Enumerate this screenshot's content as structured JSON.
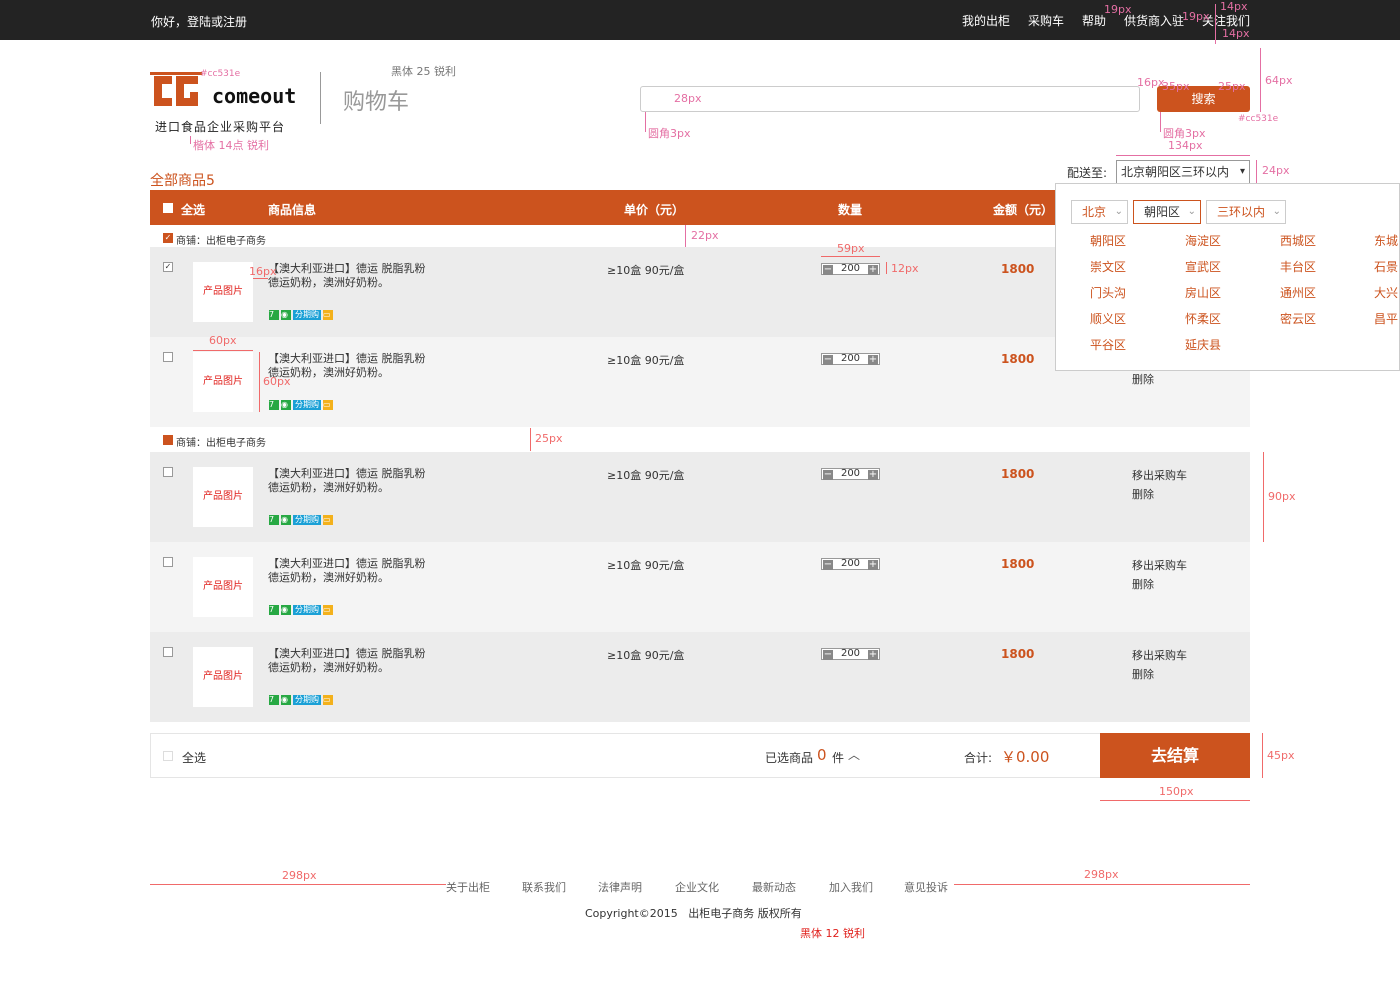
{
  "topbar": {
    "greeting": "你好，登陆或注册",
    "nav": [
      "我的出柜",
      "采购车",
      "帮助",
      "供货商入驻",
      "关注我们"
    ]
  },
  "header": {
    "logo_text": "comeout",
    "tagline": "进口食品企业采购平台",
    "page_title": "购物车",
    "search_button": "搜索",
    "brand_color": "#cc531e"
  },
  "cart": {
    "count_label": "全部商品5",
    "delivery_label": "配送至:",
    "delivery_value": "北京朝阳区三环以内",
    "columns": {
      "select_all": "全选",
      "info": "商品信息",
      "price": "单价（元）",
      "qty": "数量",
      "amount": "金额（元）"
    },
    "shops": [
      "商铺：出柜电子商务",
      "商铺：出柜电子商务"
    ],
    "item": {
      "image": "产品图片",
      "title_line1": "【澳大利亚进口】德运 脱脂乳粉",
      "title_line2": "德运奶粉，澳洲好奶粉。",
      "price": "≥10盒 90元/盒",
      "qty": "200",
      "amount": "1800",
      "remove": "移出采购车",
      "delete": "删除",
      "badge_installment": "分期购"
    }
  },
  "summary": {
    "select_all": "全选",
    "selected_prefix": "已选商品",
    "selected_count": "0",
    "selected_suffix": "件",
    "total_label": "合计:",
    "total_value": "￥0.00",
    "checkout": "去结算"
  },
  "region_popup": {
    "province": "北京",
    "district": "朝阳区",
    "ring": "三环以内",
    "districts": [
      "朝阳区",
      "海淀区",
      "西城区",
      "东城",
      "崇文区",
      "宣武区",
      "丰台区",
      "石景",
      "门头沟",
      "房山区",
      "通州区",
      "大兴",
      "顺义区",
      "怀柔区",
      "密云区",
      "昌平",
      "平谷区",
      "延庆县"
    ]
  },
  "footer": {
    "links": [
      "关于出柜",
      "联系我们",
      "法律声明",
      "企业文化",
      "最新动态",
      "加入我们",
      "意见投诉"
    ],
    "copyright": "Copyright©2015   出柜电子商务 版权所有"
  },
  "annotations": {
    "font_title": "黑体 25 锐利",
    "font_tagline": "楷体 14点 锐利",
    "font_footer": "黑体 12 锐利",
    "color1": "#cc531e",
    "color2": "#cc531e",
    "px14a": "14px",
    "px14b": "14px",
    "px19a": "19px",
    "px19b": "19px",
    "px64": "64px",
    "px28": "28px",
    "px16a": "16px",
    "px35": "35px",
    "px25a": "25px",
    "radius1": "圆角3px",
    "radius2": "圆角3px",
    "px134": "134px",
    "px24": "24px",
    "px22": "22px",
    "px59": "59px",
    "px12": "12px",
    "px16b": "16px",
    "px60a": "60px",
    "px60b": "60px",
    "px25b": "25px",
    "px90": "90px",
    "px45": "45px",
    "px150": "150px",
    "px298a": "298px",
    "px298b": "298px"
  }
}
